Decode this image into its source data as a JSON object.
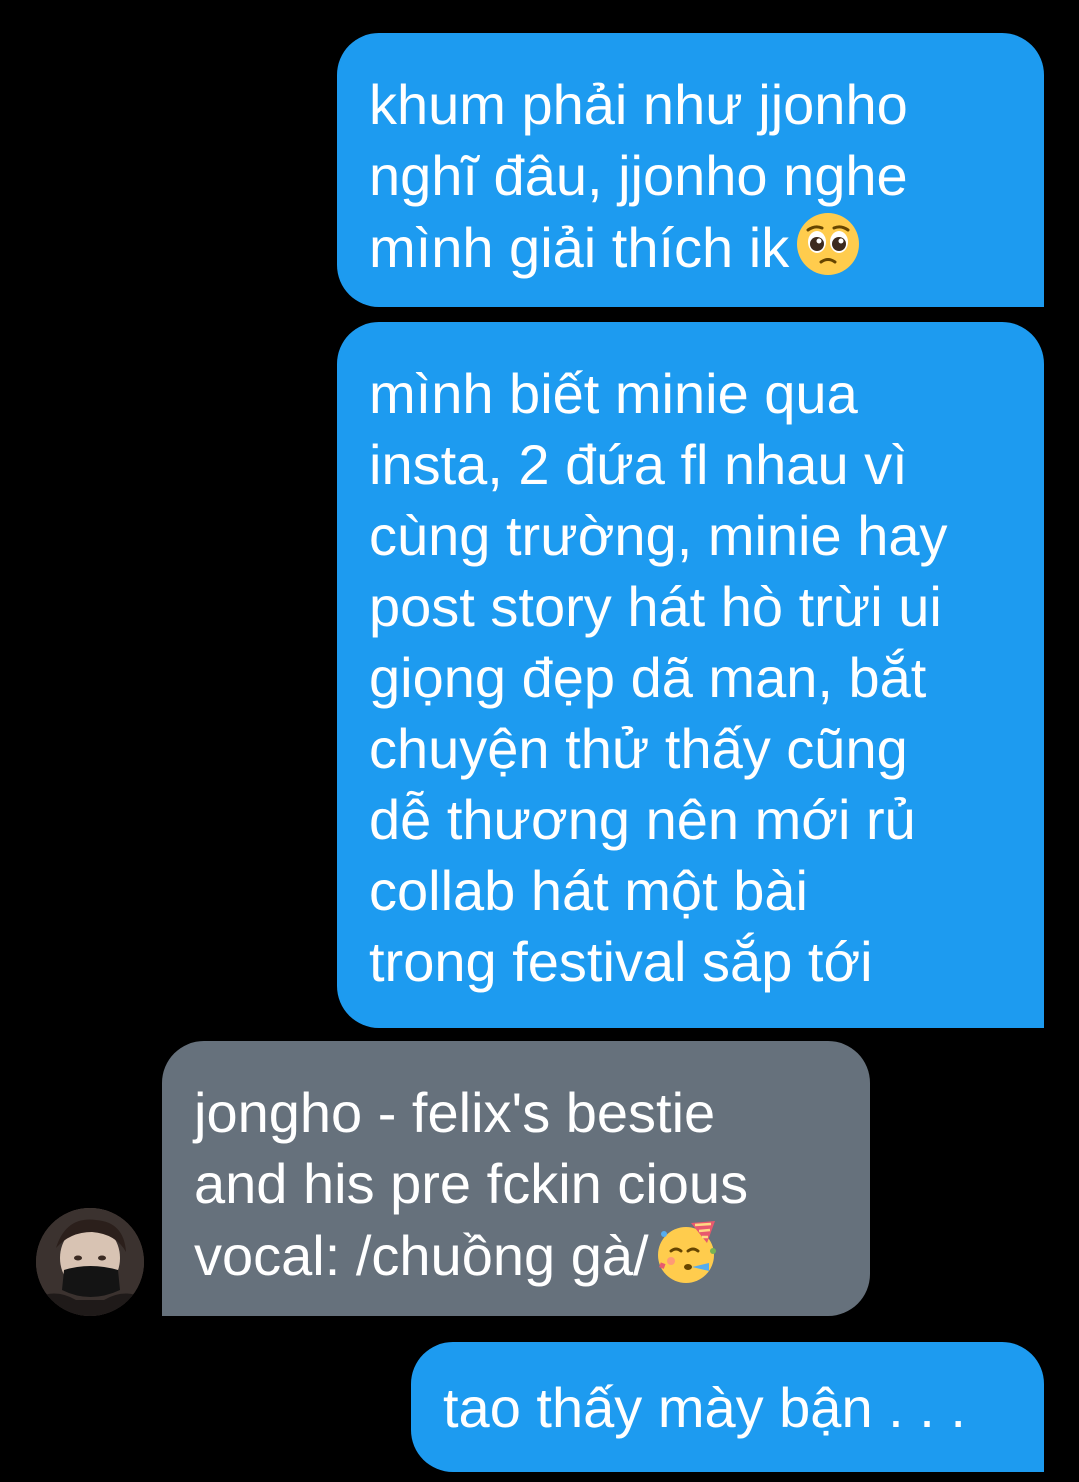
{
  "conversation": {
    "messages": [
      {
        "direction": "outgoing",
        "text": "khum phải như jjonho\nnghĩ đâu, jjonho nghe\nmình giải thích ik",
        "emoji": "pleading-face"
      },
      {
        "direction": "outgoing",
        "text": "mình biết minie qua\ninsta, 2 đứa fl nhau vì\ncùng trường, minie hay\npost story hát hò trừi ui\ngiọng đẹp dã man, bắt\nchuyện thử thấy cũng\ndễ thương nên mới rủ\ncollab hát một bài\ntrong festival sắp tới"
      },
      {
        "direction": "incoming",
        "text": "jongho - felix's bestie\nand his pre fckin cious\nvocal: /chuồng gà/",
        "emoji": "partying-face",
        "avatar": "contact-avatar"
      },
      {
        "direction": "outgoing",
        "text": "tao thấy mày bận . . ."
      }
    ]
  },
  "colors": {
    "background": "#000000",
    "outgoing_bubble": "#1d9bf0",
    "incoming_bubble": "#66717c",
    "text": "#ffffff"
  }
}
